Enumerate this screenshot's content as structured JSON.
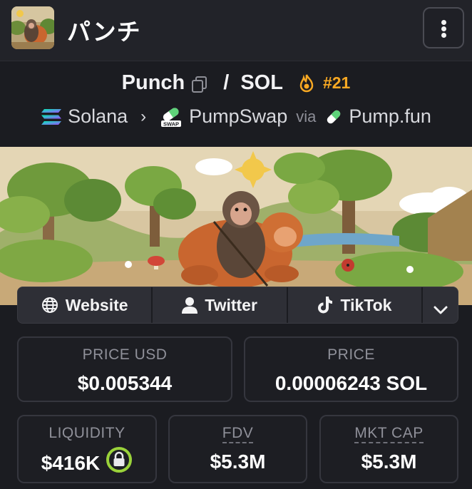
{
  "header": {
    "title": "パンチ",
    "menu_icon": "more-vertical-icon"
  },
  "pair": {
    "base": "Punch",
    "separator": "/",
    "quote": "SOL",
    "rank": "#21",
    "rank_color": "#f7a823"
  },
  "chain": {
    "network": "Solana",
    "dex": "PumpSwap",
    "via_label": "via",
    "launchpad": "Pump.fun",
    "dex_badge": "SWAP"
  },
  "links": {
    "website": "Website",
    "twitter": "Twitter",
    "tiktok": "TikTok"
  },
  "stats": {
    "price_usd": {
      "label": "PRICE USD",
      "value": "$0.005344"
    },
    "price": {
      "label": "PRICE",
      "value": "0.00006243 SOL"
    },
    "liquidity": {
      "label": "LIQUIDITY",
      "value": "$416K"
    },
    "fdv": {
      "label": "FDV",
      "value": "$5.3M"
    },
    "mkt_cap": {
      "label": "MKT CAP",
      "value": "$5.3M"
    }
  },
  "colors": {
    "background": "#1b1c21",
    "accent_orange": "#f7a823",
    "lock_green": "#9ad23a"
  }
}
